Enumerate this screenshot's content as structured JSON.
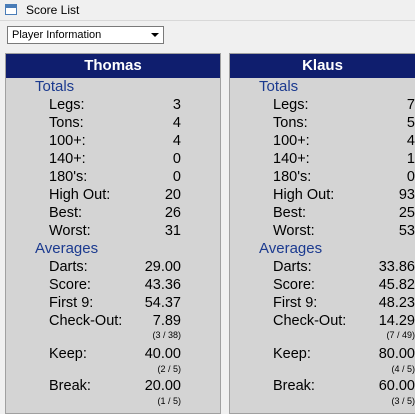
{
  "window": {
    "title": "Score List"
  },
  "toolbar": {
    "view_select": "Player Information"
  },
  "labels": {
    "totals": "Totals",
    "legs": "Legs:",
    "tons": "Tons:",
    "p100": "100+:",
    "p140": "140+:",
    "p180": "180's:",
    "high_out": "High Out:",
    "best": "Best:",
    "worst": "Worst:",
    "averages": "Averages",
    "darts": "Darts:",
    "score": "Score:",
    "first9": "First 9:",
    "checkout": "Check-Out:",
    "keep": "Keep:",
    "break": "Break:"
  },
  "players": [
    {
      "name": "Thomas",
      "legs": "3",
      "tons": "4",
      "p100": "4",
      "p140": "0",
      "p180": "0",
      "high_out": "20",
      "best": "26",
      "worst": "31",
      "darts": "29.00",
      "score": "43.36",
      "first9": "54.37",
      "checkout": "7.89",
      "checkout_detail": "(3 / 38)",
      "keep": "40.00",
      "keep_detail": "(2 / 5)",
      "break": "20.00",
      "break_detail": "(1 / 5)"
    },
    {
      "name": "Klaus",
      "legs": "7",
      "tons": "5",
      "p100": "4",
      "p140": "1",
      "p180": "0",
      "high_out": "93",
      "best": "25",
      "worst": "53",
      "darts": "33.86",
      "score": "45.82",
      "first9": "48.23",
      "checkout": "14.29",
      "checkout_detail": "(7 / 49)",
      "keep": "80.00",
      "keep_detail": "(4 / 5)",
      "break": "60.00",
      "break_detail": "(3 / 5)"
    }
  ]
}
